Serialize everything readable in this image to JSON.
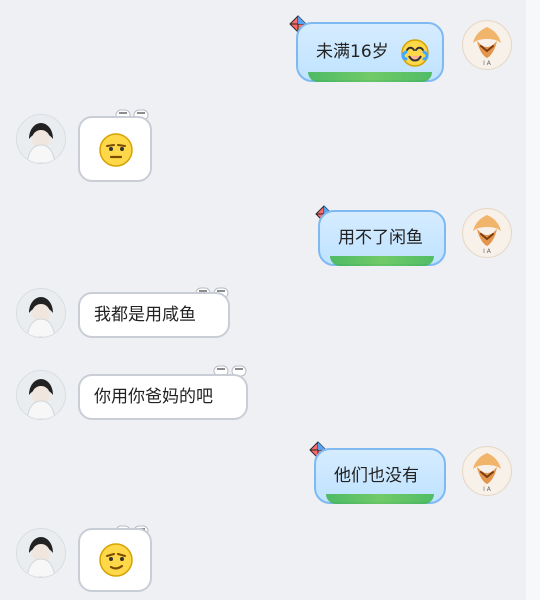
{
  "messages": [
    {
      "side": "right",
      "text": "未满16岁",
      "emoji": "crying-laughing-face-icon"
    },
    {
      "side": "left",
      "emoji": "squinting-face-icon"
    },
    {
      "side": "right",
      "text": "用不了闲鱼"
    },
    {
      "side": "left",
      "text": "我都是用咸鱼"
    },
    {
      "side": "left",
      "text": "你用你爸妈的吧"
    },
    {
      "side": "right",
      "text": "他们也没有"
    },
    {
      "side": "left",
      "emoji": "smirking-face-icon"
    }
  ],
  "colors": {
    "background": "#eef0f4",
    "right_bubble": "#c8e6ff",
    "right_border": "#7fb9f2",
    "grass": "#3db54b",
    "left_bubble": "#ffffff",
    "left_border": "#c9ced6"
  },
  "avatar_icons": {
    "self": "lion-sticker-avatar-icon",
    "other": "person-avatar-icon"
  }
}
